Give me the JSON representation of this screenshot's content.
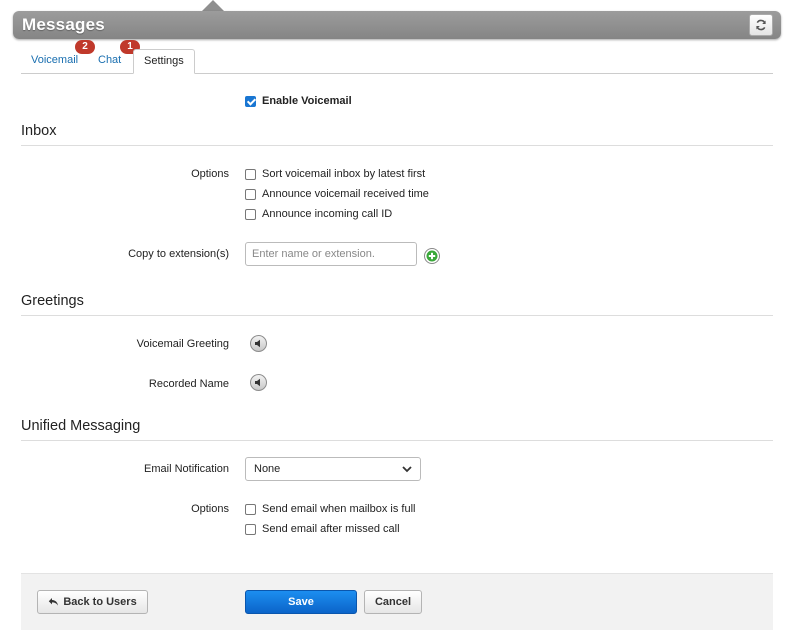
{
  "header": {
    "title": "Messages",
    "refresh_icon": "refresh-icon"
  },
  "tabs": [
    {
      "label": "Voicemail",
      "badge": "2"
    },
    {
      "label": "Chat",
      "badge": "1"
    },
    {
      "label": "Settings",
      "active": true
    }
  ],
  "enable_voicemail": {
    "label": "Enable Voicemail",
    "checked": true
  },
  "inbox": {
    "title": "Inbox",
    "options_label": "Options",
    "options": [
      {
        "label": "Sort voicemail inbox by latest first",
        "checked": false
      },
      {
        "label": "Announce voicemail received time",
        "checked": false
      },
      {
        "label": "Announce incoming call ID",
        "checked": false
      }
    ],
    "copy_label": "Copy to extension(s)",
    "copy_placeholder": "Enter name or extension."
  },
  "greetings": {
    "title": "Greetings",
    "voicemail_greeting_label": "Voicemail Greeting",
    "recorded_name_label": "Recorded Name"
  },
  "unified": {
    "title": "Unified Messaging",
    "email_label": "Email Notification",
    "email_value": "None",
    "options_label": "Options",
    "options": [
      {
        "label": "Send email when mailbox is full",
        "checked": false
      },
      {
        "label": "Send email after missed call",
        "checked": false
      }
    ]
  },
  "footer": {
    "back_label": "Back to Users",
    "save_label": "Save",
    "cancel_label": "Cancel"
  },
  "colors": {
    "primary": "#1976d2",
    "badge": "#c0392b",
    "link": "#1a6fb0",
    "titlebar": "#8f8f8f"
  }
}
